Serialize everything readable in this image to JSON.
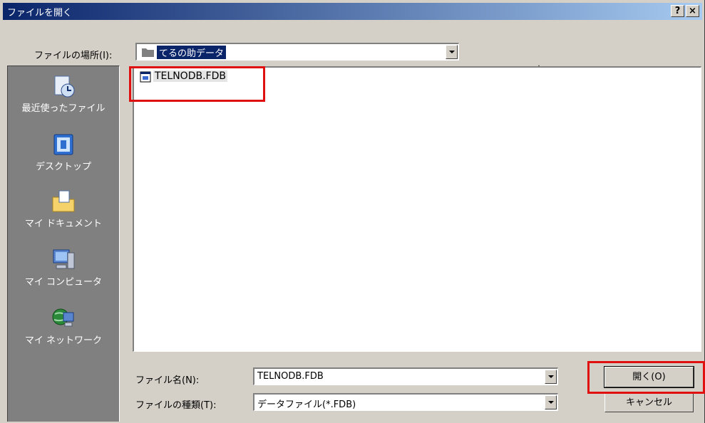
{
  "window": {
    "title": "ファイルを開く",
    "help_label": "?",
    "close_label": "×"
  },
  "location": {
    "label": "ファイルの場所(I):",
    "value": "てるの助データ"
  },
  "places": [
    {
      "label": "最近使ったファイル"
    },
    {
      "label": "デスクトップ"
    },
    {
      "label": "マイ ドキュメント"
    },
    {
      "label": "マイ コンピュータ"
    },
    {
      "label": "マイ ネットワーク"
    }
  ],
  "files": [
    {
      "name": "TELNODB.FDB"
    }
  ],
  "filename": {
    "label": "ファイル名(N):",
    "value": "TELNODB.FDB"
  },
  "filetype": {
    "label": "ファイルの種類(T):",
    "value": "データファイル(*.FDB)"
  },
  "buttons": {
    "open": "開く(O)",
    "cancel": "キャンセル"
  },
  "colors": {
    "titlebar": "#0a246a",
    "highlight": "#e01010",
    "selection": "#0a246a"
  }
}
